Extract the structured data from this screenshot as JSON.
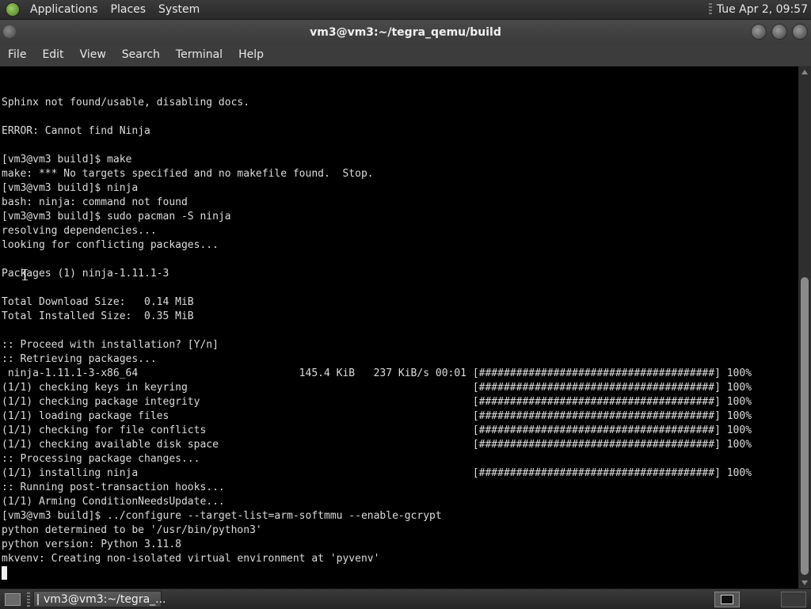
{
  "top_panel": {
    "menus": [
      "Applications",
      "Places",
      "System"
    ],
    "clock": "Tue Apr  2, 09:57"
  },
  "window": {
    "title": "vm3@vm3:~/tegra_qemu/build",
    "menus": [
      "File",
      "Edit",
      "View",
      "Search",
      "Terminal",
      "Help"
    ]
  },
  "terminal": {
    "lines": [
      "Sphinx not found/usable, disabling docs.",
      "",
      "ERROR: Cannot find Ninja",
      "",
      "[vm3@vm3 build]$ make",
      "make: *** No targets specified and no makefile found.  Stop.",
      "[vm3@vm3 build]$ ninja",
      "bash: ninja: command not found",
      "[vm3@vm3 build]$ sudo pacman -S ninja",
      "resolving dependencies...",
      "looking for conflicting packages...",
      "",
      "Packages (1) ninja-1.11.1-3",
      "",
      "Total Download Size:   0.14 MiB",
      "Total Installed Size:  0.35 MiB",
      "",
      ":: Proceed with installation? [Y/n]",
      ":: Retrieving packages...",
      " ninja-1.11.1-3-x86_64                          145.4 KiB   237 KiB/s 00:01 [######################################] 100%",
      "(1/1) checking keys in keyring                                              [######################################] 100%",
      "(1/1) checking package integrity                                            [######################################] 100%",
      "(1/1) loading package files                                                 [######################################] 100%",
      "(1/1) checking for file conflicts                                           [######################################] 100%",
      "(1/1) checking available disk space                                         [######################################] 100%",
      ":: Processing package changes...",
      "(1/1) installing ninja                                                      [######################################] 100%",
      ":: Running post-transaction hooks...",
      "(1/1) Arming ConditionNeedsUpdate...",
      "[vm3@vm3 build]$ ../configure --target-list=arm-softmmu --enable-gcrypt",
      "python determined to be '/usr/bin/python3'",
      "python version: Python 3.11.8",
      "mkvenv: Creating non-isolated virtual environment at 'pyvenv'"
    ]
  },
  "taskbar": {
    "task_label": "vm3@vm3:~/tegra_..."
  }
}
